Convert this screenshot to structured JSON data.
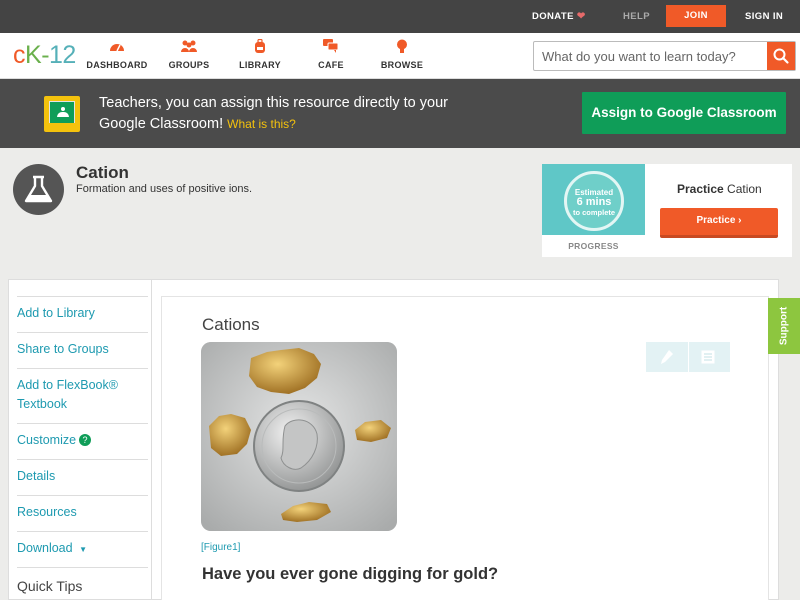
{
  "topbar": {
    "donate": "DONATE",
    "help": "HELP",
    "join": "JOIN",
    "signin": "SIGN IN"
  },
  "brand": {
    "logo_c": "c",
    "logo_k": "K",
    "logo_dash": "-",
    "logo_num": "12"
  },
  "nav": {
    "items": [
      {
        "label": "DASHBOARD",
        "icon": "speedometer-icon"
      },
      {
        "label": "GROUPS",
        "icon": "people-icon"
      },
      {
        "label": "LIBRARY",
        "icon": "backpack-icon"
      },
      {
        "label": "CAFE",
        "icon": "chat-icon"
      },
      {
        "label": "BROWSE",
        "icon": "lightbulb-icon"
      }
    ],
    "search_placeholder": "What do you want to learn today?"
  },
  "classroom_banner": {
    "text": "Teachers, you can assign this resource directly to your Google Classroom!",
    "link": "What is this?",
    "button": "Assign to Google Classroom"
  },
  "concept": {
    "title": "Cation",
    "subtitle": "Formation and uses of positive ions."
  },
  "practice": {
    "est_line1": "Estimated",
    "est_line2": "6 mins",
    "est_line3": "to complete",
    "progress": "PROGRESS",
    "title_bold": "Practice",
    "title_rest": "Cation",
    "button": "Practice"
  },
  "sidebar": {
    "items": [
      {
        "label": "Add to Library"
      },
      {
        "label": "Share to Groups"
      },
      {
        "label": "Add to FlexBook® Textbook"
      },
      {
        "label": "Customize"
      },
      {
        "label": "Details"
      },
      {
        "label": "Resources"
      },
      {
        "label": "Download"
      },
      {
        "label": "Quick Tips"
      }
    ],
    "customize_badge": "?",
    "download_caret": "▼"
  },
  "content": {
    "section_title": "Cations",
    "figure_caption": "[Figure1]",
    "question": "Have you ever gone digging for gold?",
    "support": "Support"
  },
  "colors": {
    "accent": "#f05a28",
    "topbar": "#444444",
    "banner": "#4b4b4b",
    "google_green": "#0f9d58",
    "link": "#1e9ab0",
    "support": "#8dc63f"
  }
}
